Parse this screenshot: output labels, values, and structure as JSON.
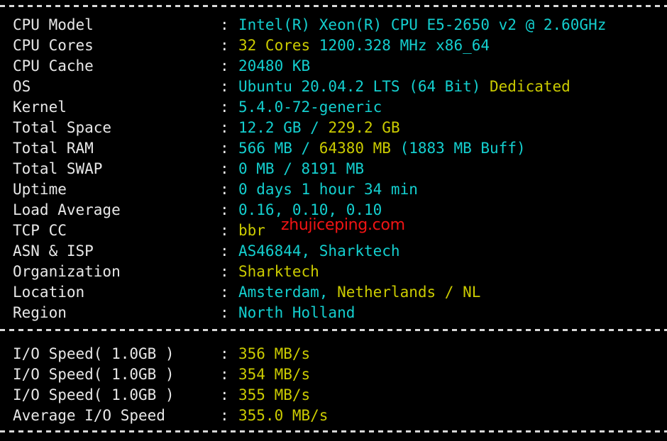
{
  "terminal": {
    "background_color": "#000000",
    "label_color": "#e8e8e8",
    "cyan": "#14cfcf",
    "yellow": "#cbcb00",
    "watermark_color": "#f01414",
    "separator_glyph": "-------------------------------------------------------------------"
  },
  "watermark": {
    "text": "zhujiceping.com"
  },
  "separator": {
    "colon": ":"
  },
  "system_info": {
    "rows": [
      {
        "label": "CPU Model",
        "parts": [
          {
            "text": "Intel(R) Xeon(R) CPU E5-2650 v2 @ 2.60GHz",
            "color": "cyan"
          }
        ]
      },
      {
        "label": "CPU Cores",
        "parts": [
          {
            "text": "32 Cores",
            "color": "yellow"
          },
          {
            "text": " 1200.328 MHz x86_64",
            "color": "cyan"
          }
        ]
      },
      {
        "label": "CPU Cache",
        "parts": [
          {
            "text": "20480 KB",
            "color": "cyan"
          }
        ]
      },
      {
        "label": "OS",
        "parts": [
          {
            "text": "Ubuntu 20.04.2 LTS (64 Bit) ",
            "color": "cyan"
          },
          {
            "text": "Dedicated",
            "color": "yellow"
          }
        ]
      },
      {
        "label": "Kernel",
        "parts": [
          {
            "text": "5.4.0-72-generic",
            "color": "cyan"
          }
        ]
      },
      {
        "label": "Total Space",
        "parts": [
          {
            "text": "12.2 GB / ",
            "color": "cyan"
          },
          {
            "text": "229.2 GB",
            "color": "yellow"
          }
        ]
      },
      {
        "label": "Total RAM",
        "parts": [
          {
            "text": "566 MB / ",
            "color": "cyan"
          },
          {
            "text": "64380 MB",
            "color": "yellow"
          },
          {
            "text": " (1883 MB Buff)",
            "color": "cyan"
          }
        ]
      },
      {
        "label": "Total SWAP",
        "parts": [
          {
            "text": "0 MB / 8191 MB",
            "color": "cyan"
          }
        ]
      },
      {
        "label": "Uptime",
        "parts": [
          {
            "text": "0 days 1 hour 34 min",
            "color": "cyan"
          }
        ]
      },
      {
        "label": "Load Average",
        "parts": [
          {
            "text": "0.16, 0.10, 0.10",
            "color": "cyan"
          }
        ]
      },
      {
        "label": "TCP CC",
        "parts": [
          {
            "text": "bbr",
            "color": "yellow"
          }
        ]
      },
      {
        "label": "ASN & ISP",
        "parts": [
          {
            "text": "AS46844, Sharktech",
            "color": "cyan"
          }
        ]
      },
      {
        "label": "Organization",
        "parts": [
          {
            "text": "Sharktech",
            "color": "yellow"
          }
        ]
      },
      {
        "label": "Location",
        "parts": [
          {
            "text": "Amsterdam, ",
            "color": "cyan"
          },
          {
            "text": "Netherlands / NL",
            "color": "yellow"
          }
        ]
      },
      {
        "label": "Region",
        "parts": [
          {
            "text": "North Holland",
            "color": "cyan"
          }
        ]
      }
    ]
  },
  "io_speed": {
    "rows": [
      {
        "label": "I/O Speed( 1.0GB )",
        "parts": [
          {
            "text": "356 MB/s",
            "color": "yellow"
          }
        ]
      },
      {
        "label": "I/O Speed( 1.0GB )",
        "parts": [
          {
            "text": "354 MB/s",
            "color": "yellow"
          }
        ]
      },
      {
        "label": "I/O Speed( 1.0GB )",
        "parts": [
          {
            "text": "355 MB/s",
            "color": "yellow"
          }
        ]
      },
      {
        "label": "Average I/O Speed",
        "parts": [
          {
            "text": "355.0 MB/s",
            "color": "yellow"
          }
        ]
      }
    ]
  }
}
